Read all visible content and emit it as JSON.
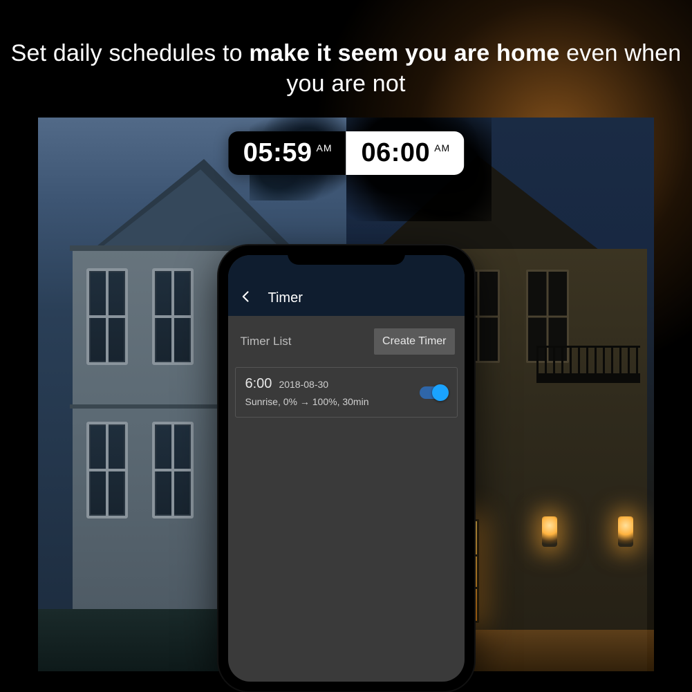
{
  "headline": {
    "part1": "Set daily schedules to ",
    "bold": "make it seem you are home",
    "part2": " even when you are not"
  },
  "time_badges": {
    "left": {
      "time": "05:59",
      "ampm": "AM"
    },
    "right": {
      "time": "06:00",
      "ampm": "AM"
    }
  },
  "phone": {
    "header": {
      "title": "Timer"
    },
    "list_header": {
      "label": "Timer List",
      "create_button": "Create Timer"
    },
    "items": [
      {
        "time": "6:00",
        "date": "2018-08-30",
        "description": "Sunrise, 0% → 100%, 30min",
        "enabled": true
      }
    ]
  }
}
